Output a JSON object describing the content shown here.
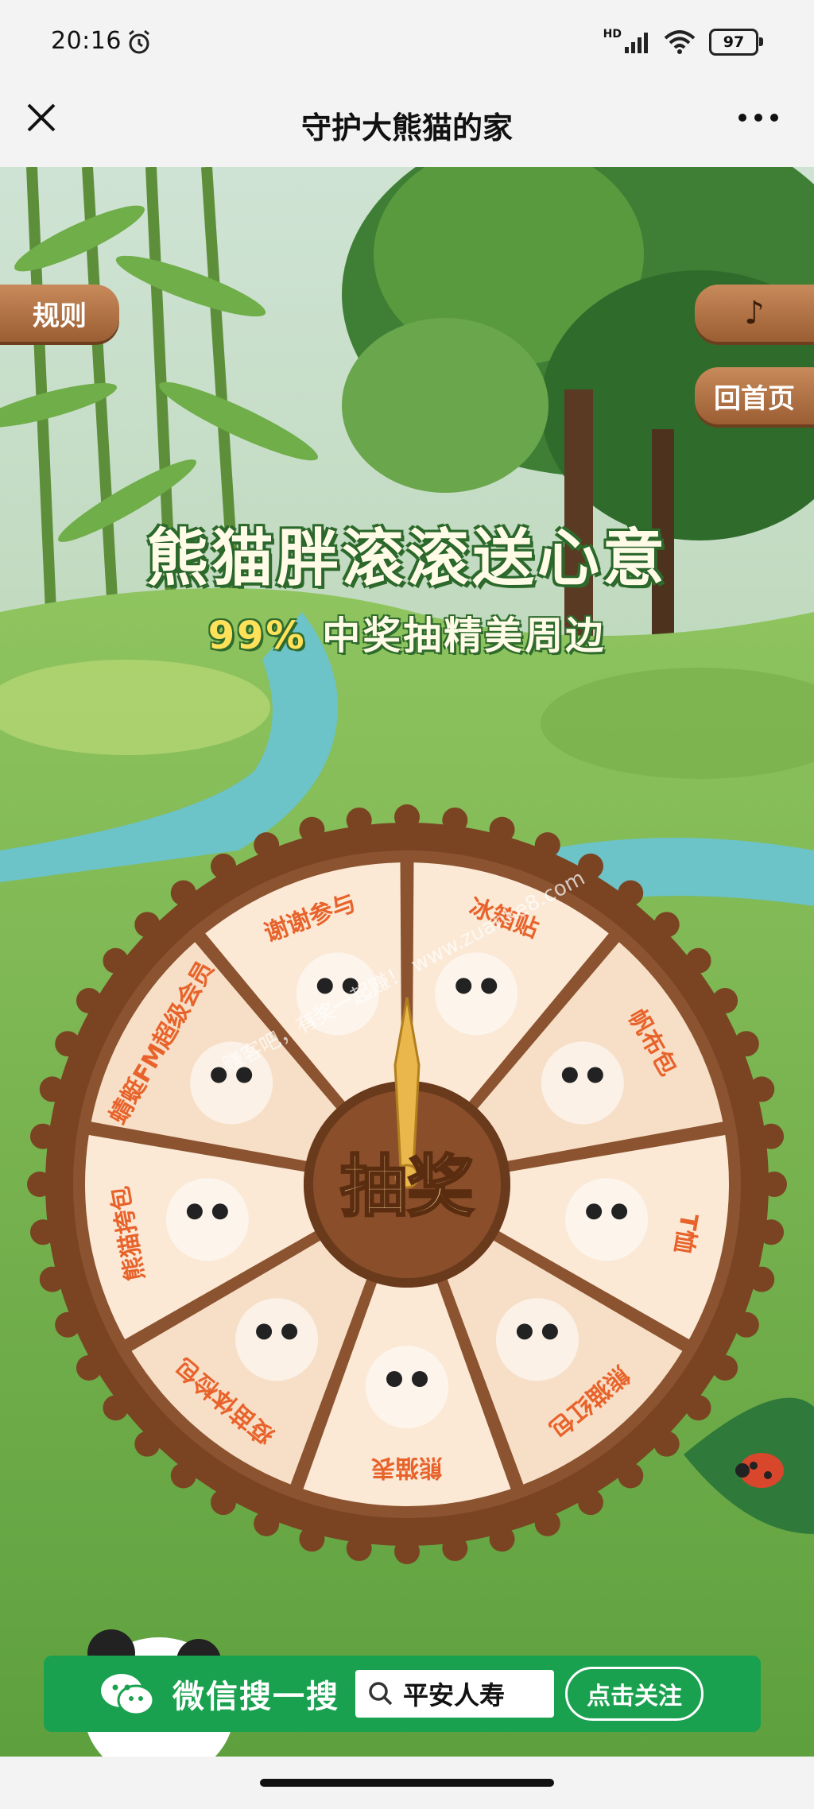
{
  "status_bar": {
    "time": "20:16",
    "network": "HD",
    "battery": "97"
  },
  "nav": {
    "title": "守护大熊猫的家"
  },
  "side_buttons": {
    "rules": "规则",
    "music_symbol": "♪",
    "home": "回首页"
  },
  "headline": {
    "main": "熊猫胖滚滚送心意",
    "sub_percent": "99%",
    "sub_text": "中奖抽精美周边"
  },
  "wheel": {
    "center_label": "抽奖",
    "prizes": [
      {
        "label": "冰箱贴",
        "icon": "panda-stickers-icon"
      },
      {
        "label": "帆布包",
        "icon": "tote-bag-icon"
      },
      {
        "label": "T恤",
        "icon": "tshirt-icon"
      },
      {
        "label": "熊猫红包",
        "icon": "red-envelope-icon"
      },
      {
        "label": "熊猫表",
        "icon": "watch-icon"
      },
      {
        "label": "疫苗体检包",
        "icon": "panda-health-icon"
      },
      {
        "label": "熊猫挎包",
        "icon": "panda-crossbody-bag-icon"
      },
      {
        "label": "蜻蜓FM超级会员",
        "icon": "vip-card-icon"
      },
      {
        "label": "谢谢参与",
        "icon": "sad-face-icon"
      }
    ],
    "colors": {
      "rim": "#7a4423",
      "teeth": "#8b5330",
      "slice": "#fbe9d6",
      "slice_alt": "#f7dfc7",
      "hub": "#8a4f2a",
      "pointer": "#e9b74b"
    }
  },
  "watermark": "赚客吧，有奖一起赚！ www.zuanke8.com",
  "banner": {
    "prefix": "微信搜一搜",
    "search_term": "平安人寿",
    "follow_label": "点击关注"
  },
  "colors": {
    "wechat_green": "#19a14f",
    "headline_yellow": "#ffe15a",
    "prize_text": "#e8632b"
  }
}
